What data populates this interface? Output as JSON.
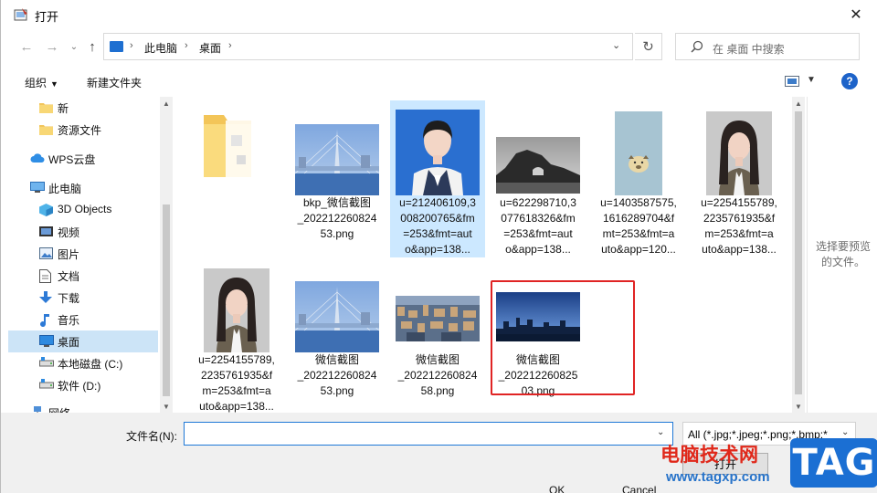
{
  "window": {
    "title": "打开",
    "close_glyph": "✕"
  },
  "address": {
    "segments": [
      "此电脑",
      "桌面"
    ],
    "search_placeholder": "在 桌面 中搜索"
  },
  "toolbar": {
    "organize_label": "组织",
    "new_folder_label": "新建文件夹"
  },
  "nav": {
    "items": [
      {
        "label": "新",
        "icon": "folder-icon"
      },
      {
        "label": "资源文件",
        "icon": "folder-icon"
      },
      {
        "label": "WPS云盘",
        "icon": "cloud-icon"
      },
      {
        "label": "此电脑",
        "icon": "computer-icon"
      },
      {
        "label": "3D Objects",
        "icon": "cube-icon"
      },
      {
        "label": "视频",
        "icon": "video-icon"
      },
      {
        "label": "图片",
        "icon": "picture-icon"
      },
      {
        "label": "文档",
        "icon": "document-icon"
      },
      {
        "label": "下载",
        "icon": "download-icon"
      },
      {
        "label": "音乐",
        "icon": "music-icon"
      },
      {
        "label": "桌面",
        "icon": "desktop-icon",
        "selected": true
      },
      {
        "label": "本地磁盘 (C:)",
        "icon": "drive-icon"
      },
      {
        "label": "软件 (D:)",
        "icon": "drive-icon"
      },
      {
        "label": "网络",
        "icon": "network-icon"
      }
    ]
  },
  "files": [
    {
      "name": "",
      "kind": "folder"
    },
    {
      "name": "bkp_微信截图\n_202212260824\n53.png",
      "kind": "bridge"
    },
    {
      "name": "u=212406109,3\n008200765&fm\n=253&fmt=aut\no&app=138...",
      "kind": "portrait-blue",
      "selected": true
    },
    {
      "name": "u=622298710,3\n077618326&fm\n=253&fmt=aut\no&app=138...",
      "kind": "rock"
    },
    {
      "name": "u=1403587575,\n1616289704&f\nmt=253&fmt=a\nuto&app=120...",
      "kind": "dog"
    },
    {
      "name": "u=2254155789,\n2235761935&f\nm=253&fmt=a\nuto&app=138...",
      "kind": "portrait-grey"
    },
    {
      "name": "u=2254155789,\n2235761935&f\nm=253&fmt=a\nuto&app=138...",
      "kind": "portrait-grey"
    },
    {
      "name": "微信截图\n_202212260824\n53.png",
      "kind": "bridge"
    },
    {
      "name": "微信截图\n_202212260824\n58.png",
      "kind": "city"
    },
    {
      "name": "微信截图\n_202212260825\n03.png",
      "kind": "skyline"
    }
  ],
  "preview": {
    "text": "选择要预览的文件。"
  },
  "bottom": {
    "filename_label": "文件名(N):",
    "filename_value": "",
    "filter_value": "All (*.jpg;*.jpeg;*.png;*.bmp;*",
    "open_label": "打开",
    "ok_label": "OK",
    "cancel_label": "Cancel"
  },
  "watermark": {
    "title": "电脑技术网",
    "url": "www.tagxp.com",
    "tag": "TAG"
  }
}
